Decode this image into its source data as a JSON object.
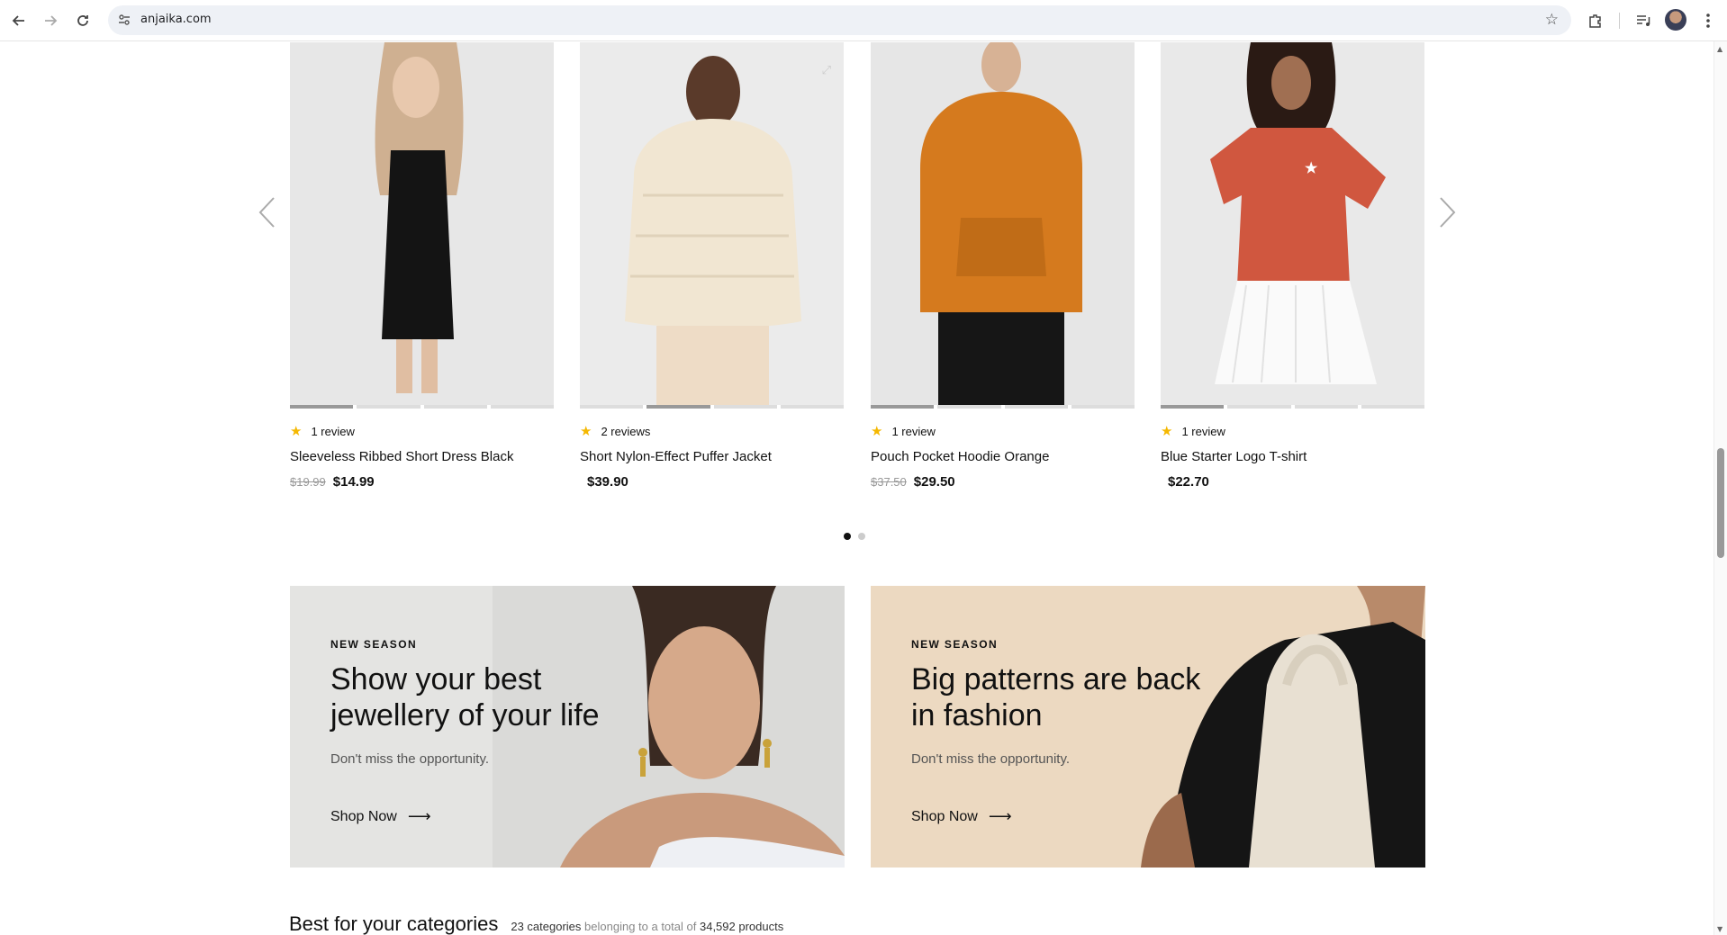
{
  "browser": {
    "url": "anjaika.com",
    "back_icon": "arrow-left-icon",
    "forward_icon": "arrow-right-icon",
    "reload_icon": "reload-icon"
  },
  "carousel": {
    "products": [
      {
        "reviews": "1 review",
        "name": "Sleeveless Ribbed Short Dress Black",
        "old_price": "$19.99",
        "price": "$14.99",
        "image_dot_active": 0
      },
      {
        "reviews": "2 reviews",
        "name": "Short Nylon-Effect Puffer Jacket",
        "old_price": "",
        "price": "$39.90",
        "image_dot_active": 1
      },
      {
        "reviews": "1 review",
        "name": "Pouch Pocket Hoodie Orange",
        "old_price": "$37.50",
        "price": "$29.50",
        "image_dot_active": 0
      },
      {
        "reviews": "1 review",
        "name": "Blue Starter Logo T-shirt",
        "old_price": "",
        "price": "$22.70",
        "image_dot_active": 0
      }
    ],
    "page_count": 2,
    "active_page": 1
  },
  "banners": [
    {
      "eyebrow": "NEW SEASON",
      "headline": "Show your best jewellery of your life",
      "sub": "Don't miss the opportunity.",
      "cta": "Shop Now",
      "bg": "#e4e4e2"
    },
    {
      "eyebrow": "NEW SEASON",
      "headline": "Big patterns are back in fashion",
      "sub": "Don't miss the opportunity.",
      "cta": "Shop Now",
      "bg": "#ecd9c1"
    }
  ],
  "categories": {
    "title": "Best for your categories",
    "count": "23 categories",
    "mid": "belonging to a total of",
    "total": "34,592 products"
  },
  "colors": {
    "star": "#f5b800",
    "text": "#111111"
  }
}
